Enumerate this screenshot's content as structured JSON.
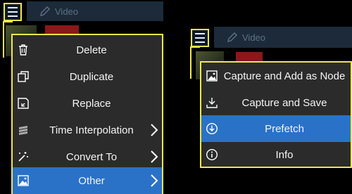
{
  "colors": {
    "highlight": "#f0e84a",
    "menu_bg": "#2b2b2b",
    "active_bg": "#2a72c8",
    "header_bg": "#1d2a3a",
    "text": "#f4f4f4"
  },
  "left_panel": {
    "header_label": "Video",
    "menu": [
      {
        "label": "Delete",
        "icon": "trash-icon",
        "submenu": false,
        "active": false
      },
      {
        "label": "Duplicate",
        "icon": "duplicate-icon",
        "submenu": false,
        "active": false
      },
      {
        "label": "Replace",
        "icon": "replace-icon",
        "submenu": false,
        "active": false
      },
      {
        "label": "Time Interpolation",
        "icon": "layers-icon",
        "submenu": true,
        "active": false
      },
      {
        "label": "Convert To",
        "icon": "magic-wand-icon",
        "submenu": true,
        "active": false
      },
      {
        "label": "Other",
        "icon": "image-icon",
        "submenu": true,
        "active": true
      }
    ]
  },
  "right_panel": {
    "header_label": "Video",
    "menu": [
      {
        "label": "Capture and Add as Node",
        "icon": "image-icon",
        "submenu": false,
        "active": false
      },
      {
        "label": "Capture and Save",
        "icon": "download-icon",
        "submenu": false,
        "active": false
      },
      {
        "label": "Prefetch",
        "icon": "download-circle-icon",
        "submenu": false,
        "active": true
      },
      {
        "label": "Info",
        "icon": "info-icon",
        "submenu": false,
        "active": false
      }
    ]
  }
}
